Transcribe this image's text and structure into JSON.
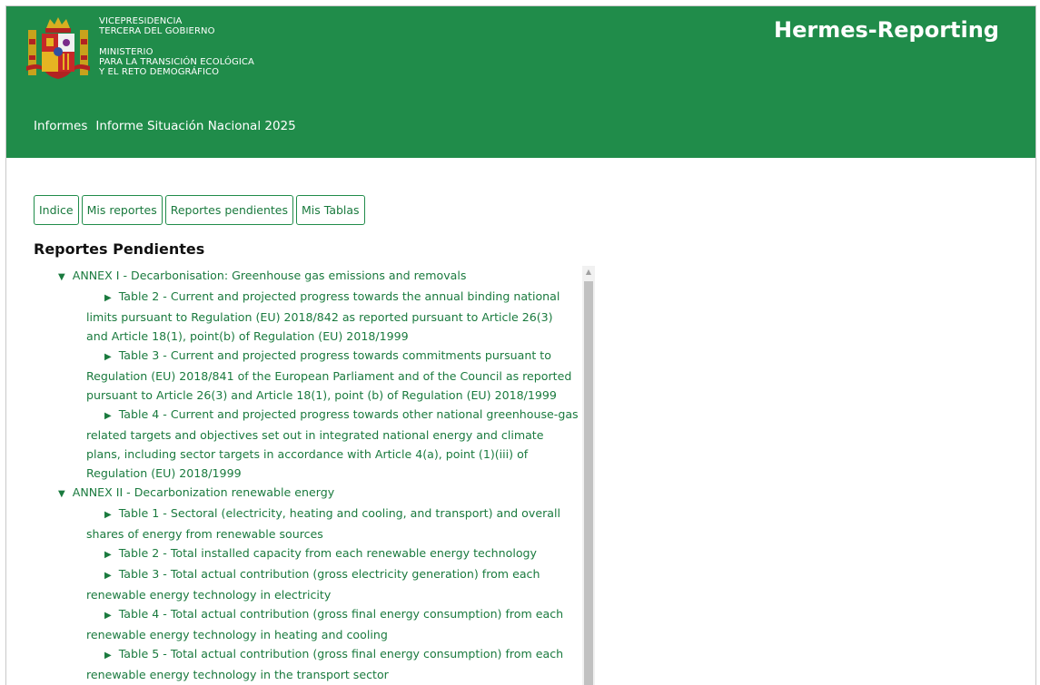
{
  "header": {
    "ministry_lines_1": [
      "VICEPRESIDENCIA",
      "TERCERA DEL GOBIERNO"
    ],
    "ministry_lines_2": [
      "MINISTERIO",
      "PARA LA TRANSICIÓN ECOLÓGICA",
      "Y EL RETO DEMOGRÁFICO"
    ],
    "app_title": "Hermes-Reporting",
    "breadcrumb": [
      "Informes",
      "Informe Situación Nacional 2025"
    ]
  },
  "tabs": [
    "Indice",
    "Mis reportes",
    "Reportes pendientes",
    "Mis Tablas"
  ],
  "section_title": "Reportes Pendientes",
  "tree": [
    {
      "label": "ANNEX I - Decarbonisation: Greenhouse gas emissions and removals",
      "expanded": true,
      "items": [
        [
          "Table 2 - Current and projected progress towards the annual binding national",
          "limits pursuant to Regulation (EU) 2018/842 as reported pursuant to Article 26(3)",
          "and Article 18(1), point(b) of Regulation (EU) 2018/1999"
        ],
        [
          "Table 3 - Current and projected progress towards commitments pursuant to",
          "Regulation (EU) 2018/841 of the European Parliament and of the Council as reported",
          "pursuant to Article 26(3) and Article 18(1), point (b) of Regulation (EU) 2018/1999"
        ],
        [
          "Table 4 - Current and projected progress towards other national greenhouse-gas",
          "related targets and objectives set out in integrated national energy and climate",
          "plans, including sector targets in accordance with Article 4(a), point (1)(iii) of",
          "Regulation (EU) 2018/1999"
        ]
      ]
    },
    {
      "label": "ANNEX II - Decarbonization renewable energy",
      "expanded": true,
      "items": [
        [
          "Table 1 - Sectoral (electricity, heating and cooling, and transport) and overall",
          "shares of energy from renewable sources"
        ],
        [
          "Table 2 - Total installed capacity from each renewable energy technology"
        ],
        [
          "Table 3 - Total actual contribution (gross electricity generation) from each",
          "renewable energy technology in electricity"
        ],
        [
          "Table 4 - Total actual contribution (gross final energy consumption) from each",
          "renewable energy technology in heating and cooling"
        ],
        [
          "Table 5 - Total actual contribution (gross final energy consumption) from each",
          "renewable energy technology in the transport sector"
        ]
      ]
    }
  ],
  "colors": {
    "header_bg": "#208c4a",
    "link_green": "#1a7a3e"
  }
}
